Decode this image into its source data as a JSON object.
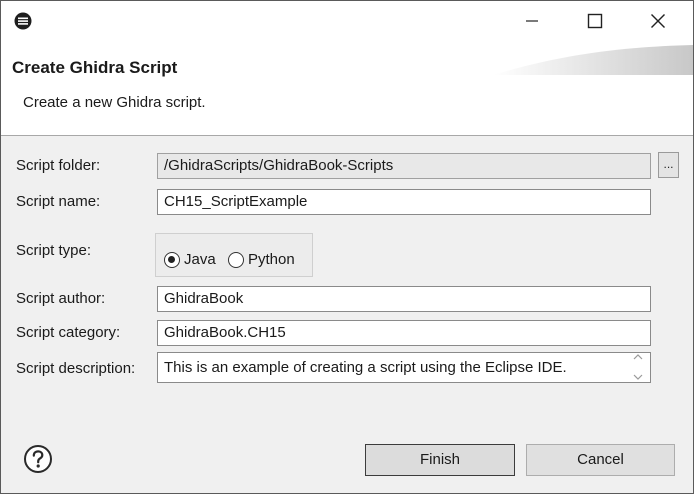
{
  "window": {
    "icons": {
      "app": "app-icon",
      "minimize": "minimize-icon",
      "maximize": "maximize-icon",
      "close": "close-icon"
    }
  },
  "header": {
    "title": "Create Ghidra Script",
    "subtitle": "Create a new Ghidra script."
  },
  "form": {
    "folder": {
      "label": "Script folder:",
      "value": "/GhidraScripts/GhidraBook-Scripts",
      "browse_label": "..."
    },
    "name": {
      "label": "Script name:",
      "value": "CH15_ScriptExample"
    },
    "type": {
      "label": "Script type:",
      "options": [
        {
          "label": "Java",
          "selected": true
        },
        {
          "label": "Python",
          "selected": false
        }
      ]
    },
    "author": {
      "label": "Script author:",
      "value": "GhidraBook"
    },
    "category": {
      "label": "Script category:",
      "value": "GhidraBook.CH15"
    },
    "description": {
      "label": "Script description:",
      "value": "This is an example of creating a script using the Eclipse IDE."
    }
  },
  "footer": {
    "help_icon": "help-icon",
    "finish_label": "Finish",
    "cancel_label": "Cancel"
  }
}
